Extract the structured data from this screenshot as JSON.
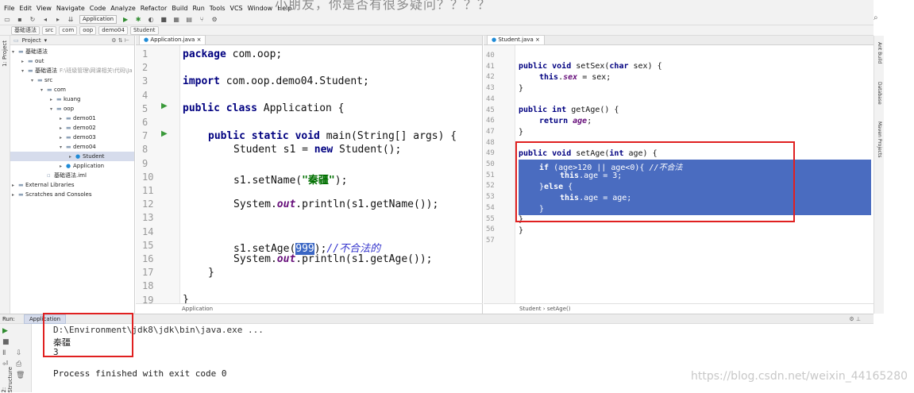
{
  "overlay_text": "小朋友，你是否有很多疑问？？？？",
  "menu": [
    "File",
    "Edit",
    "View",
    "Navigate",
    "Code",
    "Analyze",
    "Refactor",
    "Build",
    "Run",
    "Tools",
    "VCS",
    "Window",
    "Help"
  ],
  "toolbar": {
    "run_config": "Application"
  },
  "breadcrumb": [
    "基础语法",
    "src",
    "com",
    "oop",
    "demo04",
    "Student"
  ],
  "project_panel": {
    "title": "Project",
    "tree": [
      {
        "label": "基础语法",
        "indent": 0,
        "arrow": "▾",
        "icon": "module"
      },
      {
        "label": "out",
        "indent": 1,
        "arrow": "▸",
        "icon": "folder"
      },
      {
        "label": "基础语法",
        "extra": "F:\\班级管理\\网课相关\\代码\\Ja",
        "indent": 1,
        "arrow": "▾",
        "icon": "module"
      },
      {
        "label": "src",
        "indent": 2,
        "arrow": "▾",
        "icon": "folder"
      },
      {
        "label": "com",
        "indent": 3,
        "arrow": "▾",
        "icon": "folder"
      },
      {
        "label": "kuang",
        "indent": 4,
        "arrow": "▸",
        "icon": "folder"
      },
      {
        "label": "oop",
        "indent": 4,
        "arrow": "▾",
        "icon": "folder"
      },
      {
        "label": "demo01",
        "indent": 5,
        "arrow": "▸",
        "icon": "folder"
      },
      {
        "label": "demo02",
        "indent": 5,
        "arrow": "▸",
        "icon": "folder"
      },
      {
        "label": "demo03",
        "indent": 5,
        "arrow": "▸",
        "icon": "folder"
      },
      {
        "label": "demo04",
        "indent": 5,
        "arrow": "▾",
        "icon": "folder"
      },
      {
        "label": "Student",
        "indent": 6,
        "arrow": "▸",
        "icon": "class",
        "selected": true
      },
      {
        "label": "Application",
        "indent": 5,
        "arrow": "▸",
        "icon": "class"
      },
      {
        "label": "基础语法.iml",
        "indent": 3,
        "arrow": "",
        "icon": "file"
      },
      {
        "label": "External Libraries",
        "indent": 0,
        "arrow": "▸",
        "icon": "lib"
      },
      {
        "label": "Scratches and Consoles",
        "indent": 0,
        "arrow": "▸",
        "icon": "lib"
      }
    ]
  },
  "left_editor": {
    "tab": "Application.java",
    "status": "Application",
    "line_numbers": [
      "1",
      "2",
      "3",
      "4",
      "5",
      "6",
      "7",
      "8",
      "9",
      "10",
      "11",
      "12",
      "13",
      "14",
      "15",
      "16",
      "17",
      "18",
      "19"
    ],
    "code": {
      "l1_kw": "package",
      "l1_rest": " com.oop;",
      "l3_kw": "import",
      "l3_rest": " com.oop.demo04.Student;",
      "l5_kw": "public class",
      "l5_rest": " Application {",
      "l7_kw": "public static void",
      "l7_rest": " main(String[] args) {",
      "l8_a": "Student s1 = ",
      "l8_kw": "new",
      "l8_b": " Student();",
      "l10_a": "s1.setName(",
      "l10_str": "\"秦疆\"",
      "l10_b": ");",
      "l12_a": "System.",
      "l12_fld": "out",
      "l12_b": ".println(s1.getName());",
      "l15_a": "s1.setAge(",
      "l15_num": "999",
      "l15_b": ");",
      "l15_cmt": "//不合法的",
      "l16_a": "System.",
      "l16_fld": "out",
      "l16_b": ".println(s1.getAge());",
      "l17": "}",
      "l19": "}"
    }
  },
  "right_editor": {
    "tab": "Student.java",
    "status_a": "Student",
    "status_b": "setAge()",
    "line_numbers": [
      "40",
      "41",
      "42",
      "43",
      "44",
      "45",
      "46",
      "47",
      "48",
      "49",
      "50",
      "51",
      "52",
      "53",
      "54",
      "55",
      "56",
      "57"
    ],
    "code": {
      "l41_kw": "public void",
      "l41_rest": " setSex(",
      "l41_kw2": "char",
      "l41_rest2": " sex) {",
      "l42_kw": "this",
      "l42_a": ".",
      "l42_fld": "sex",
      "l42_b": " = sex;",
      "l43": "}",
      "l45_kw": "public int",
      "l45_rest": " getAge() {",
      "l46_kw": "return",
      "l46_fld": " age",
      "l46_b": ";",
      "l47": "}",
      "l49_kw": "public void",
      "l49_rest": " setAge(",
      "l49_kw2": "int",
      "l49_rest2": " age) {",
      "l50_kw": "if",
      "l50_rest": " (age>120 || age<0){ ",
      "l50_cmt": "//不合法",
      "l51_kw": "this",
      "l51_rest": ".age = 3;",
      "l52_a": "}",
      "l52_kw": "else",
      "l52_b": " {",
      "l53_kw": "this",
      "l53_rest": ".age = age;",
      "l54": "}",
      "l55": "}",
      "l56": "}"
    }
  },
  "right_strip": [
    "Ant Build",
    "Database",
    "Maven Projects"
  ],
  "left_strip": [
    "1: Project",
    "2: Structure"
  ],
  "run_panel": {
    "label": "Run:",
    "tab": "Application",
    "path": "D:\\Environment\\jdk8\\jdk\\bin\\java.exe ...",
    "out1": "秦疆",
    "out2": "3",
    "finish": "Process finished with exit code 0"
  },
  "watermark": "https://blog.csdn.net/weixin_44165280"
}
